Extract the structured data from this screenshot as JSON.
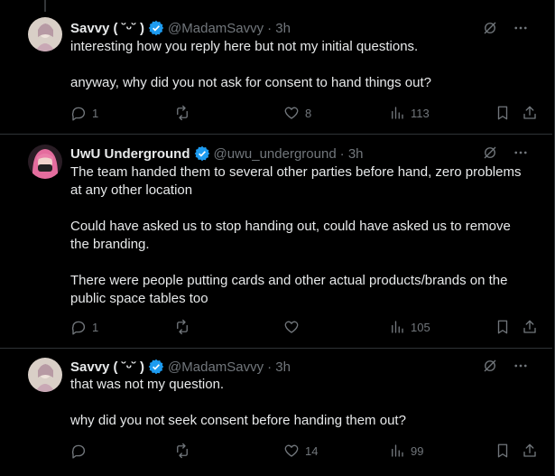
{
  "tweets": [
    {
      "name": "Savvy ( ˘ᵕ˘ )",
      "handle": "@MadamSavvy",
      "time": "· 3h",
      "paragraphs": [
        "interesting how you reply here but not my initial questions.",
        "anyway, why did you not ask for consent to hand things out?"
      ],
      "replies": "1",
      "reposts": "",
      "likes": "8",
      "views": "113"
    },
    {
      "name": "UwU Underground",
      "handle": "@uwu_underground",
      "time": "· 3h",
      "paragraphs": [
        "The team handed them to several other parties before hand, zero problems at any other location",
        "Could have asked us to stop handing out, could have asked us to remove the branding.",
        "There were people putting cards and other actual products/brands on the public space tables too"
      ],
      "replies": "1",
      "reposts": "",
      "likes": "",
      "views": "105"
    },
    {
      "name": "Savvy ( ˘ᵕ˘ )",
      "handle": "@MadamSavvy",
      "time": "· 3h",
      "paragraphs": [
        "that was not my question.",
        "why did you not seek consent before handing them out?"
      ],
      "replies": "",
      "reposts": "",
      "likes": "14",
      "views": "99"
    }
  ],
  "colors": {
    "verified": "#1d9bf0",
    "muted": "#71767b",
    "text": "#e7e9ea",
    "border": "#2f3336"
  }
}
